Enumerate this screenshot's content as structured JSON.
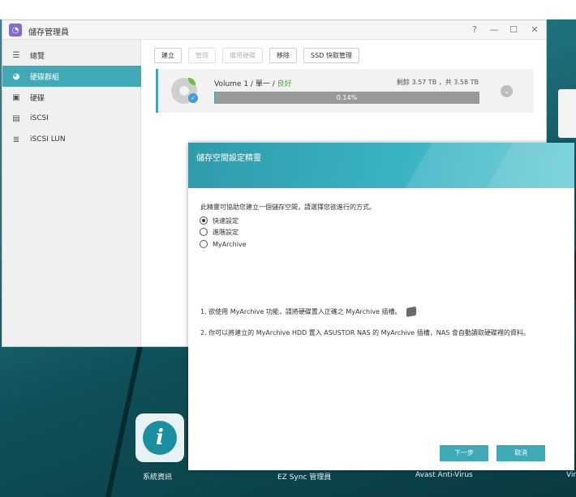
{
  "window": {
    "title": "儲存管理員",
    "controls": {
      "help": "?",
      "minimize": "—",
      "maximize": "☐",
      "close": "✕"
    }
  },
  "sidebar": {
    "items": [
      {
        "label": "總覽",
        "icon": "overview-icon",
        "active": false
      },
      {
        "label": "硬碟群組",
        "icon": "volume-icon",
        "active": true
      },
      {
        "label": "硬碟",
        "icon": "disk-icon",
        "active": false
      },
      {
        "label": "iSCSI",
        "icon": "iscsi-icon",
        "active": false
      },
      {
        "label": "iSCSI LUN",
        "icon": "iscsi-lun-icon",
        "active": false
      }
    ]
  },
  "toolbar": {
    "create": "建立",
    "manage": "管理",
    "spare_disk": "備用硬碟",
    "remove": "移除",
    "ssd_cache": "SSD 快取管理"
  },
  "volume": {
    "name_prefix": "Volume 1 / 單一 / ",
    "status": "良好",
    "capacity": "剩餘 3.57 TB ，共 3.58 TB",
    "usage_percent": 0.14,
    "usage_label": "0.14%"
  },
  "wizard": {
    "title": "儲存空間設定精靈",
    "intro": "此精靈可協助您建立一個儲存空間，請選擇您欲進行的方式。",
    "options": [
      {
        "label": "快速設定",
        "checked": true
      },
      {
        "label": "進階設定",
        "checked": false
      },
      {
        "label": "MyArchive",
        "checked": false
      }
    ],
    "note1": "1. 欲使用 MyArchive 功能，請將硬碟置入正確之 MyArchive 插槽。",
    "note2": "2. 你可以將建立的 MyArchive HDD 置入 ASUSTOR NAS 的 MyArchive 插槽，NAS 會自動讀取硬碟裡的資料。",
    "next": "下一步",
    "cancel": "取消"
  },
  "desktop": {
    "labels": [
      "系統資訊",
      "EZ Sync 管理員",
      "Avast Anti-Virus",
      "Vir"
    ]
  },
  "colors": {
    "accent": "#3fa9b5",
    "ok": "#58a83d"
  }
}
